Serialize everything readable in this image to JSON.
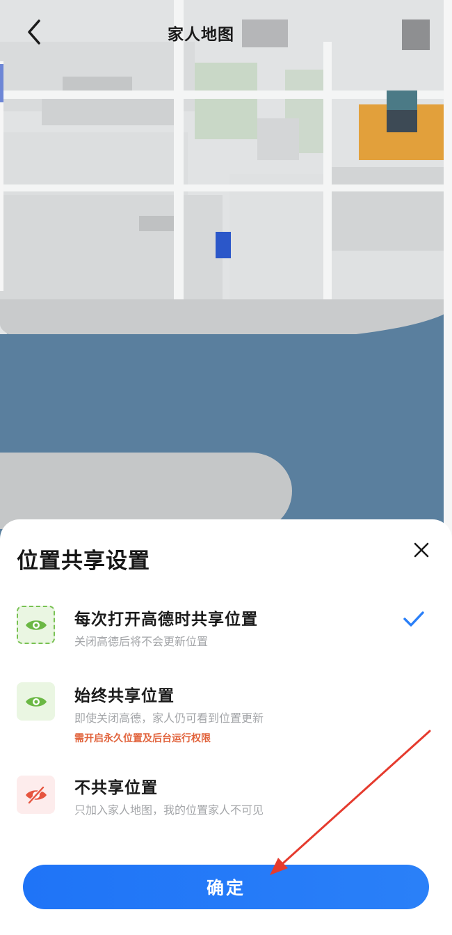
{
  "header": {
    "title": "家人地图"
  },
  "sheet": {
    "title": "位置共享设置",
    "options": [
      {
        "label": "每次打开高德时共享位置",
        "description": "关闭高德后将不会更新位置",
        "selected": true,
        "icon": "eye-icon"
      },
      {
        "label": "始终共享位置",
        "description": "即使关闭高德，家人仍可看到位置更新",
        "warning": "需开启永久位置及后台运行权限",
        "selected": false,
        "icon": "eye-icon"
      },
      {
        "label": "不共享位置",
        "description": "只加入家人地图，我的位置家人不可见",
        "selected": false,
        "icon": "eye-off-icon"
      }
    ],
    "confirm_label": "确定"
  },
  "colors": {
    "accent": "#2a7ff8",
    "green": "#6bb844",
    "red": "#e6553f",
    "warning": "#e1633c",
    "river": "#5a7f9e"
  }
}
